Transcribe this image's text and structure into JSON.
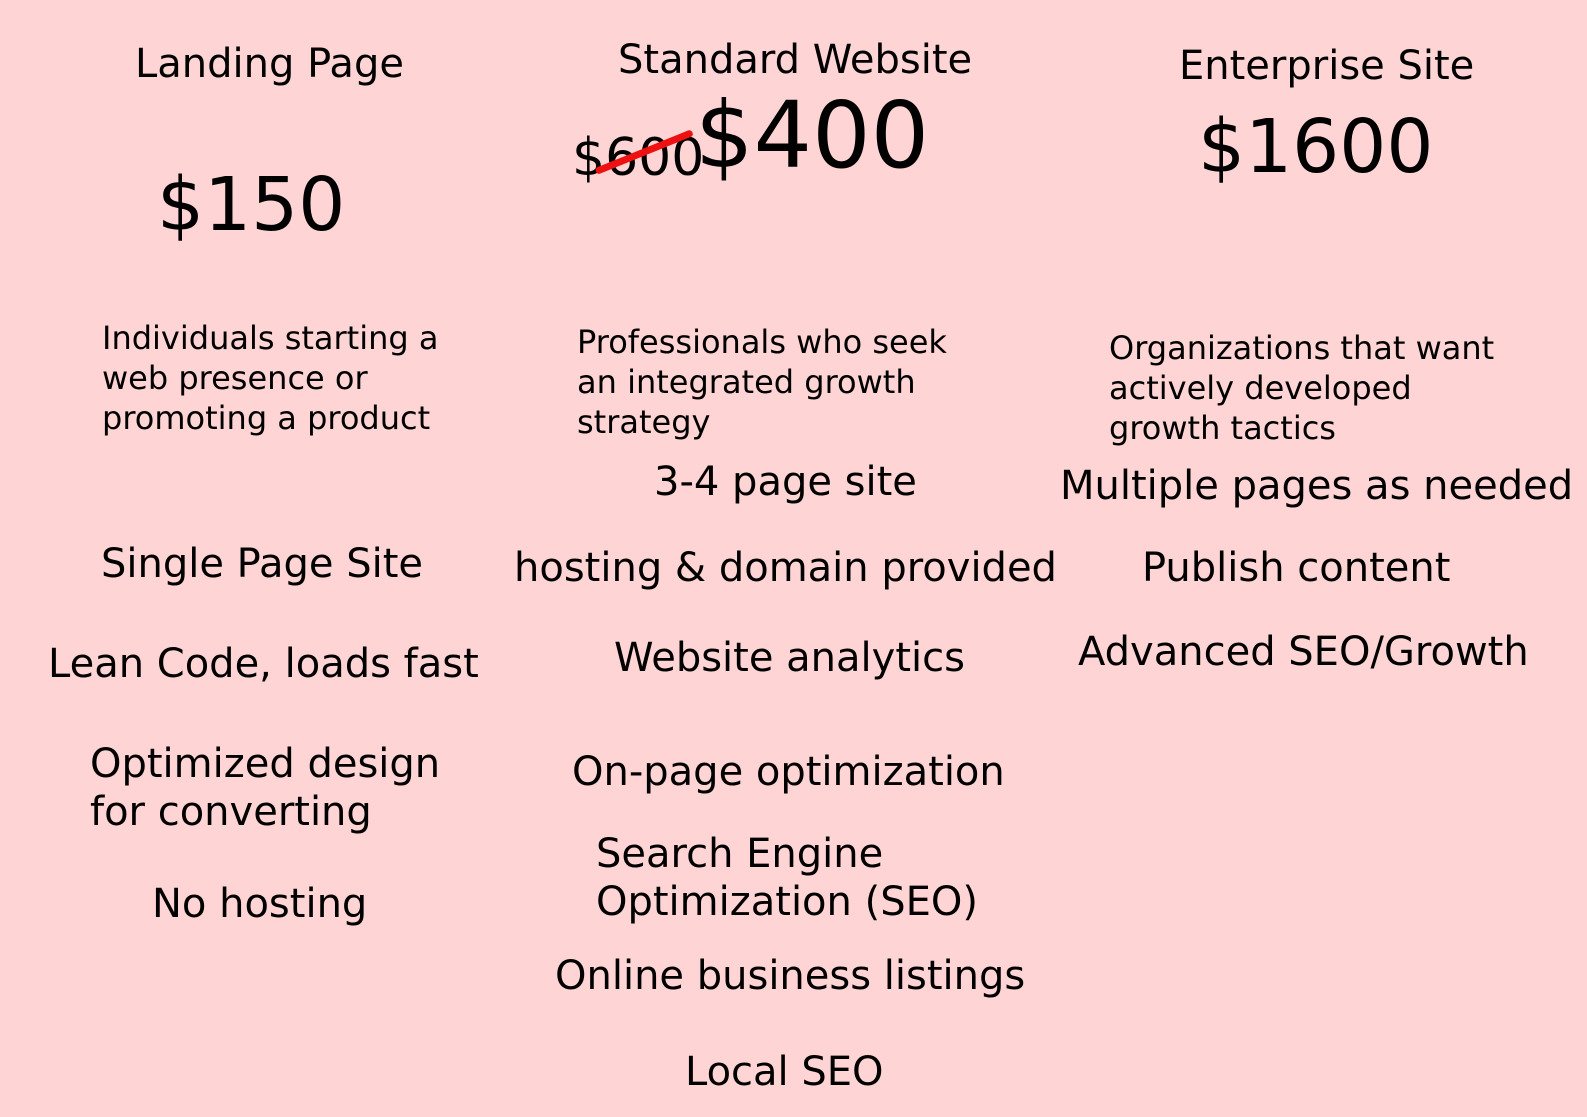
{
  "colors": {
    "background": "#ffd4d4",
    "text": "#000000",
    "strikethrough": "#ee1111"
  },
  "plans": {
    "landing": {
      "title": "Landing Page",
      "price": "$150",
      "description": "Individuals starting a web presence or promoting a product",
      "features": [
        "Single Page Site",
        "Lean Code, loads fast",
        "Optimized design for converting",
        "No hosting"
      ]
    },
    "standard": {
      "title": "Standard Website",
      "old_price": "$600",
      "price": "$400",
      "description": "Professionals who seek an integrated growth strategy",
      "features": [
        "3-4 page site",
        "hosting & domain provided",
        "Website analytics",
        "On-page optimization",
        "Search Engine Optimization (SEO)",
        "Online business listings",
        "Local SEO"
      ]
    },
    "enterprise": {
      "title": "Enterprise Site",
      "price": "$1600",
      "description": "Organizations that want actively developed growth tactics",
      "features": [
        "Multiple pages as needed",
        "Publish content",
        "Advanced SEO/Growth"
      ]
    }
  }
}
